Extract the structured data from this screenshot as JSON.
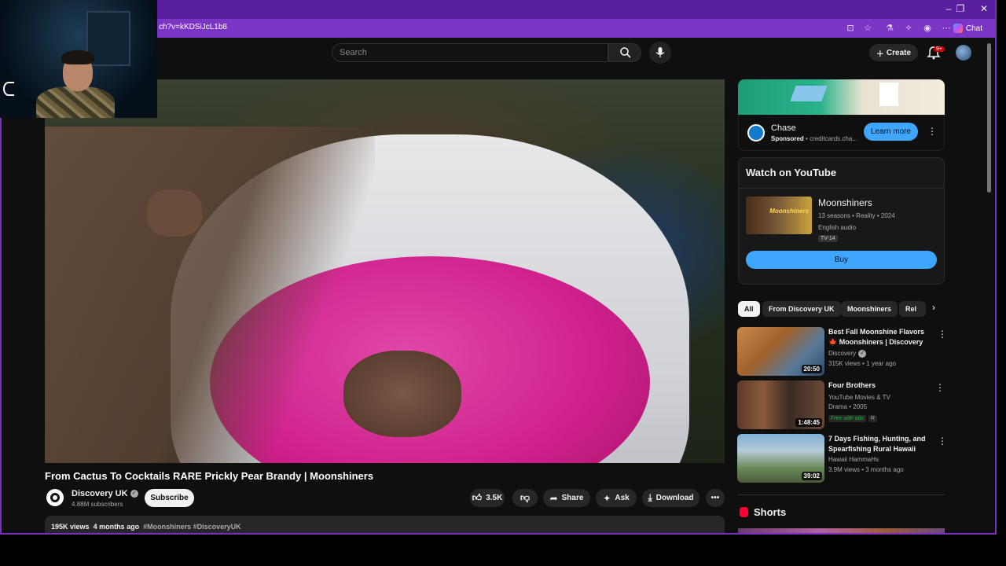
{
  "browser": {
    "url": "ch?v=kKDSiJcL1b8",
    "chat_label": "Chat",
    "window_controls": [
      "–",
      "❐",
      "✕"
    ]
  },
  "header": {
    "search_placeholder": "Search",
    "create_label": "Create",
    "notification_count": "9+"
  },
  "video": {
    "title": "From Cactus To Cocktails RARE Prickly Pear Brandy | Moonshiners",
    "channel_name": "Discovery UK",
    "subscribers": "4.88M subscribers",
    "subscribe_label": "Subscribe",
    "likes": "3.5K",
    "share_label": "Share",
    "ask_label": "Ask",
    "download_label": "Download",
    "views": "195K views",
    "age": "4 months ago",
    "hashtags": "#Moonshiners #DiscoveryUK"
  },
  "ad": {
    "advertiser": "Chase",
    "sponsored": "Sponsored",
    "domain": "creditcards.cha...",
    "cta": "Learn more"
  },
  "watch_on_youtube": {
    "heading": "Watch on YouTube",
    "show_title": "Moonshiners",
    "meta": "13 seasons • Reality • 2024",
    "audio": "English audio",
    "rating": "TV-14",
    "buy_label": "Buy"
  },
  "chips": [
    "All",
    "From Discovery UK",
    "Moonshiners",
    "Rel"
  ],
  "recommendations": [
    {
      "title": "Best Fall Moonshine Flavors 🍁 Moonshiners | Discovery",
      "channel": "Discovery",
      "stats": "315K views • 1 year ago",
      "duration": "20:50"
    },
    {
      "title": "Four Brothers",
      "channel": "YouTube Movies & TV",
      "stats": "Drama • 2005",
      "badge": "Free with ads",
      "rating": "R",
      "duration": "1:48:45"
    },
    {
      "title": "7 Days Fishing, Hunting, and Spearfishing Rural Hawaii",
      "channel": "Hawaii HammaHs",
      "stats": "3.9M views • 3 months ago",
      "duration": "39:02"
    }
  ],
  "shorts": {
    "heading": "Shorts"
  },
  "colors": {
    "frame_accent": "#7b2fbf",
    "page_bg": "#0f0f0f",
    "link_blue": "#3ea6ff",
    "brand_red": "#ff0033"
  }
}
